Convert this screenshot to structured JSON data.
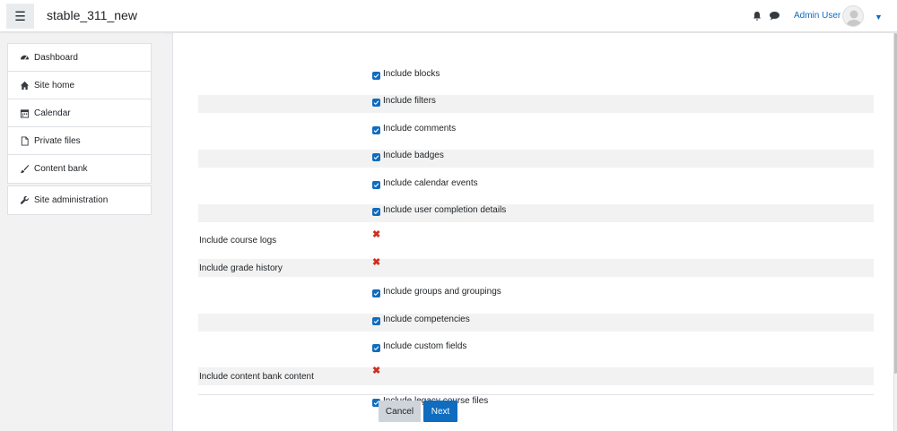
{
  "navbar": {
    "site_name": "stable_311_new",
    "user_name": "Admin User",
    "menu_icon": "hamburger-icon",
    "notifications_icon": "bell-icon",
    "messages_icon": "chat-icon",
    "user_menu_icon": "caret-down-icon"
  },
  "drawer": {
    "items": [
      {
        "label": "Dashboard",
        "icon": "tachometer-icon"
      },
      {
        "label": "Site home",
        "icon": "home-icon"
      },
      {
        "label": "Calendar",
        "icon": "calendar-icon"
      },
      {
        "label": "Private files",
        "icon": "file-icon"
      },
      {
        "label": "Content bank",
        "icon": "paint-brush-icon"
      }
    ],
    "admin": {
      "label": "Site administration",
      "icon": "wrench-icon"
    }
  },
  "settings": [
    {
      "label": "",
      "text": "Include blocks",
      "state": "checked",
      "shaded": false
    },
    {
      "label": "",
      "text": "Include filters",
      "state": "checked",
      "shaded": true
    },
    {
      "label": "",
      "text": "Include comments",
      "state": "checked",
      "shaded": false
    },
    {
      "label": "",
      "text": "Include badges",
      "state": "checked",
      "shaded": true
    },
    {
      "label": "",
      "text": "Include calendar events",
      "state": "checked",
      "shaded": false
    },
    {
      "label": "",
      "text": "Include user completion details",
      "state": "checked",
      "shaded": true
    },
    {
      "label": "Include course logs",
      "text": "",
      "state": "disabled",
      "shaded": false
    },
    {
      "label": "Include grade history",
      "text": "",
      "state": "disabled",
      "shaded": true
    },
    {
      "label": "",
      "text": "Include groups and groupings",
      "state": "checked",
      "shaded": false
    },
    {
      "label": "",
      "text": "Include competencies",
      "state": "checked",
      "shaded": true
    },
    {
      "label": "",
      "text": "Include custom fields",
      "state": "checked",
      "shaded": false
    },
    {
      "label": "Include content bank content",
      "text": "",
      "state": "disabled",
      "shaded": true
    },
    {
      "label": "",
      "text": "Include legacy course files",
      "state": "checked",
      "shaded": false
    }
  ],
  "buttons": {
    "cancel": "Cancel",
    "next": "Next"
  },
  "colors": {
    "primary": "#0f6cbf",
    "danger": "#ca3120",
    "secondary": "#ced4da"
  }
}
